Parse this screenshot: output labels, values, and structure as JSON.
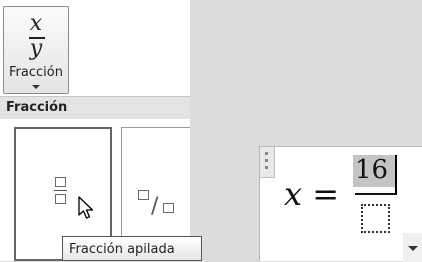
{
  "ribbon": {
    "fraction_button": {
      "numerator_glyph": "x",
      "denominator_glyph": "y",
      "label": "Fracción"
    }
  },
  "gallery": {
    "header": "Fracción",
    "items": [
      {
        "icon": "stacked-fraction-icon"
      },
      {
        "icon": "skewed-fraction-icon"
      }
    ],
    "tooltip": "Fracción apilada"
  },
  "equation": {
    "variable": "x",
    "equals": "=",
    "numerator": "16"
  }
}
